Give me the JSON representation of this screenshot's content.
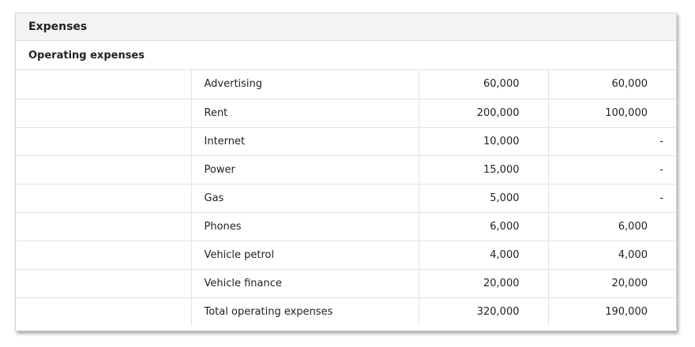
{
  "card": {
    "title": "Expenses"
  },
  "section": {
    "title": "Operating expenses"
  },
  "rows": [
    {
      "label": "Advertising",
      "col1": "60,000",
      "col2": "60,000"
    },
    {
      "label": "Rent",
      "col1": "200,000",
      "col2": "100,000"
    },
    {
      "label": "Internet",
      "col1": "10,000",
      "col2": "-"
    },
    {
      "label": "Power",
      "col1": "15,000",
      "col2": "-"
    },
    {
      "label": "Gas",
      "col1": "5,000",
      "col2": "-"
    },
    {
      "label": "Phones",
      "col1": "6,000",
      "col2": "6,000"
    },
    {
      "label": "Vehicle petrol",
      "col1": "4,000",
      "col2": "4,000"
    },
    {
      "label": "Vehicle finance",
      "col1": "20,000",
      "col2": "20,000"
    },
    {
      "label": "Total operating expenses",
      "col1": "320,000",
      "col2": "190,000"
    }
  ]
}
